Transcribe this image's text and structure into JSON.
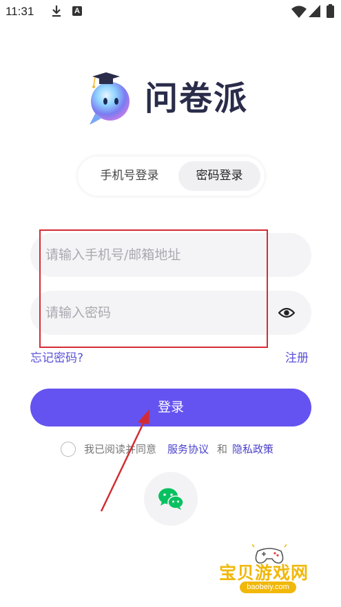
{
  "status_bar": {
    "time": "11:31",
    "download_icon": "download-icon",
    "a_badge": "A",
    "wifi_icon": "wifi-icon",
    "signal_icon": "signal-icon",
    "battery_icon": "battery-icon"
  },
  "header": {
    "logo_icon": "mascot-logo-icon",
    "app_name": "问卷派"
  },
  "login_tabs": {
    "phone_label": "手机号登录",
    "password_label": "密码登录",
    "selected": "密码登录"
  },
  "form": {
    "account_placeholder": "请输入手机号/邮箱地址",
    "account_value": "",
    "password_placeholder": "请输入密码",
    "password_value": "",
    "toggle_visibility_icon": "eye-icon"
  },
  "links": {
    "forgot_password": "忘记密码?",
    "register": "注册"
  },
  "login_button_label": "登录",
  "agreement": {
    "text": "我已阅读并同意",
    "service_link": "服务协议",
    "and": "和",
    "privacy_link": "隐私政策",
    "checked": false
  },
  "third_party": {
    "wechat_icon": "wechat-icon"
  },
  "watermark": {
    "title": "宝贝游戏网",
    "url": "baobeiy.com"
  },
  "colors": {
    "accent": "#6453f0",
    "link": "#5a50d8",
    "annotation_red": "#d42b33",
    "wechat_green": "#07c160",
    "watermark_gold": "#f1b80a"
  }
}
